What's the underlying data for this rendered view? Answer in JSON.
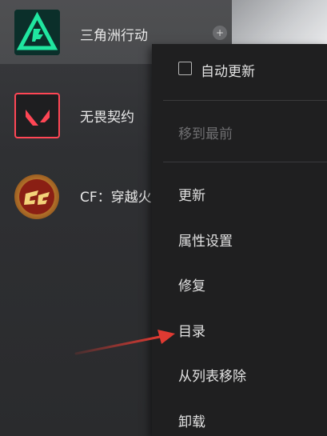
{
  "games": [
    {
      "title": "三角洲行动",
      "icon": "delta-force-icon"
    },
    {
      "title": "无畏契约",
      "icon": "valorant-icon"
    },
    {
      "title": "CF：穿越火线",
      "icon": "crossfire-icon"
    }
  ],
  "context_menu": {
    "auto_update": {
      "label": "自动更新",
      "checked": false
    },
    "move_to_top": {
      "label": "移到最前",
      "disabled": true
    },
    "items": [
      "更新",
      "属性设置",
      "修复",
      "目录",
      "从列表移除",
      "卸载"
    ]
  },
  "colors": {
    "accent_arrow": "#e03a32",
    "menu_bg": "#1f1f20",
    "delta_green": "#20e6a0",
    "valorant_red": "#ff4655"
  }
}
